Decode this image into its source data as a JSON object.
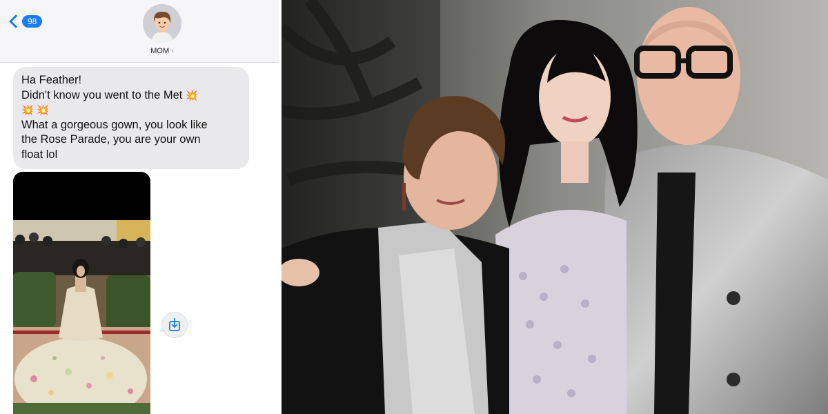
{
  "messages": {
    "back_badge": "98",
    "contact_name": "MOM",
    "contact_chevron": "›",
    "bubble_lines": [
      "Ha Feather!",
      "Didn't know you went to the Met",
      "What a gorgeous gown, you look like",
      "the Rose Parade, you are your own",
      "float lol"
    ],
    "emoji": "💥",
    "image_name": "met-gala-floral-gown-photo",
    "download_icon": "download-icon"
  },
  "photo": {
    "description_name": "family-photo-at-event"
  },
  "colors": {
    "imessage_blue": "#1a7cf5",
    "bubble_gray": "#e9e9eb",
    "header_bg": "#f6f6f8"
  }
}
